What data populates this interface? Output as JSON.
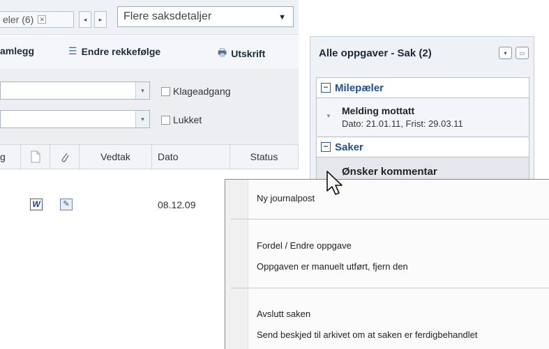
{
  "tabs": {
    "active_tab_label": "eler (6)",
    "close_glyph": "✕",
    "prev_glyph": "◂",
    "next_glyph": "▸",
    "details_select_value": "Flere saksdetaljer",
    "details_select_arrow": "▼"
  },
  "toolbar": {
    "item1": "amlegg",
    "item2": "Endre rekkefølge",
    "item3": "Utskrift",
    "icon2": "☰",
    "icon3": "🖶"
  },
  "filters": {
    "combo_arrow": "▾",
    "chk1": "Klageadgang",
    "chk2": "Lukket"
  },
  "table": {
    "headers": [
      "g",
      "",
      "",
      "Vedtak",
      "Dato",
      "Status"
    ],
    "row": {
      "word": "W",
      "edit": "✎",
      "date": "08.12.09"
    }
  },
  "right_panel": {
    "title": "Alle oppgaver - Sak (2)",
    "btn1": "▾",
    "btn2": "▭",
    "section1": "Milepæler",
    "item1_title": "Melding mottatt",
    "item1_sub": "Dato: 21.01.11, Frist: 29.03.11",
    "section2": "Saker",
    "item2_title": "Ønsker kommentar",
    "minus": "−",
    "tri": "▼"
  },
  "context_menu": {
    "items": [
      "Ny journalpost",
      "Fordel / Endre oppgave",
      "Oppgaven er manuelt utført, fjern den",
      "Avslutt saken",
      "Send beskjed til arkivet om at saken er ferdigbehandlet"
    ]
  },
  "colors": {
    "accent": "#1f4f96",
    "panel_bg": "#eef1f5"
  }
}
